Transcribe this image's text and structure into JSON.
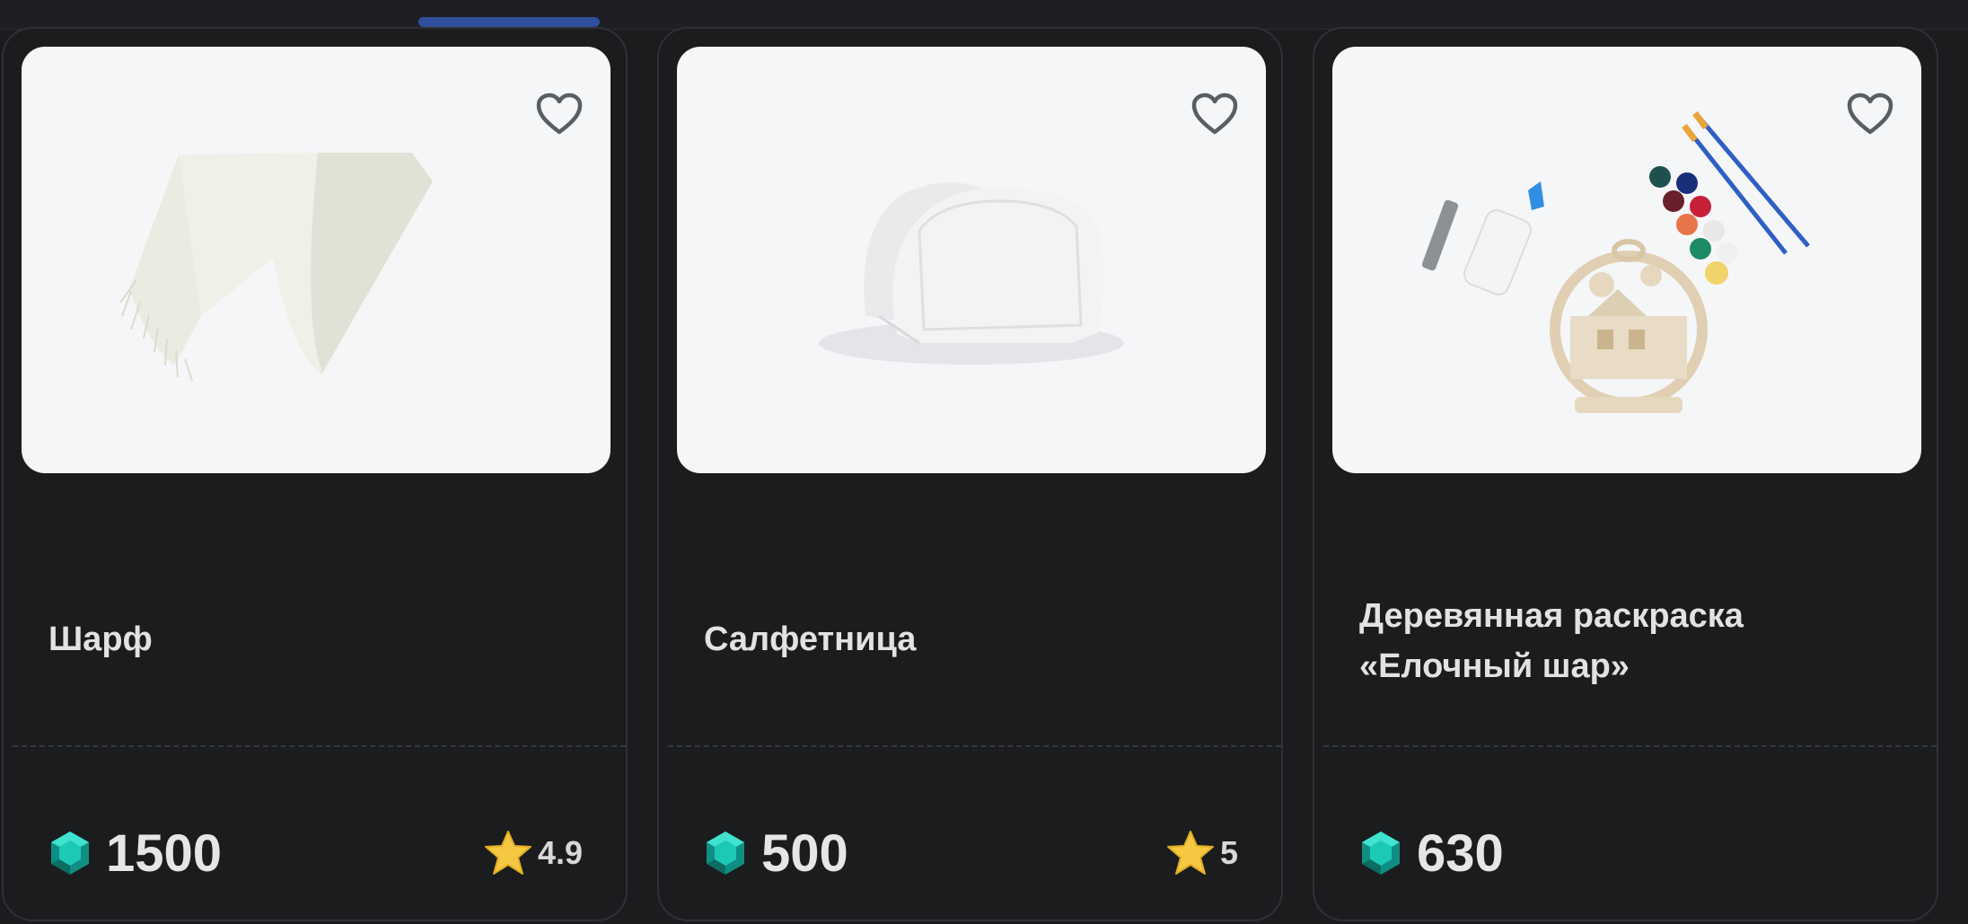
{
  "products": [
    {
      "title": "Шарф",
      "price": "1500",
      "rating": "4.9"
    },
    {
      "title": "Салфетница",
      "price": "500",
      "rating": "5"
    },
    {
      "title": "Деревянная раскраска «Елочный шар»",
      "price": "630"
    }
  ],
  "colors": {
    "background": "#1b1c1e",
    "accent": "#2f4f9e",
    "gem": "#17b8a6",
    "star": "#f5c842"
  },
  "icons": {
    "favorite": "heart-outline-icon",
    "currency": "gem-icon",
    "rating": "star-icon"
  }
}
